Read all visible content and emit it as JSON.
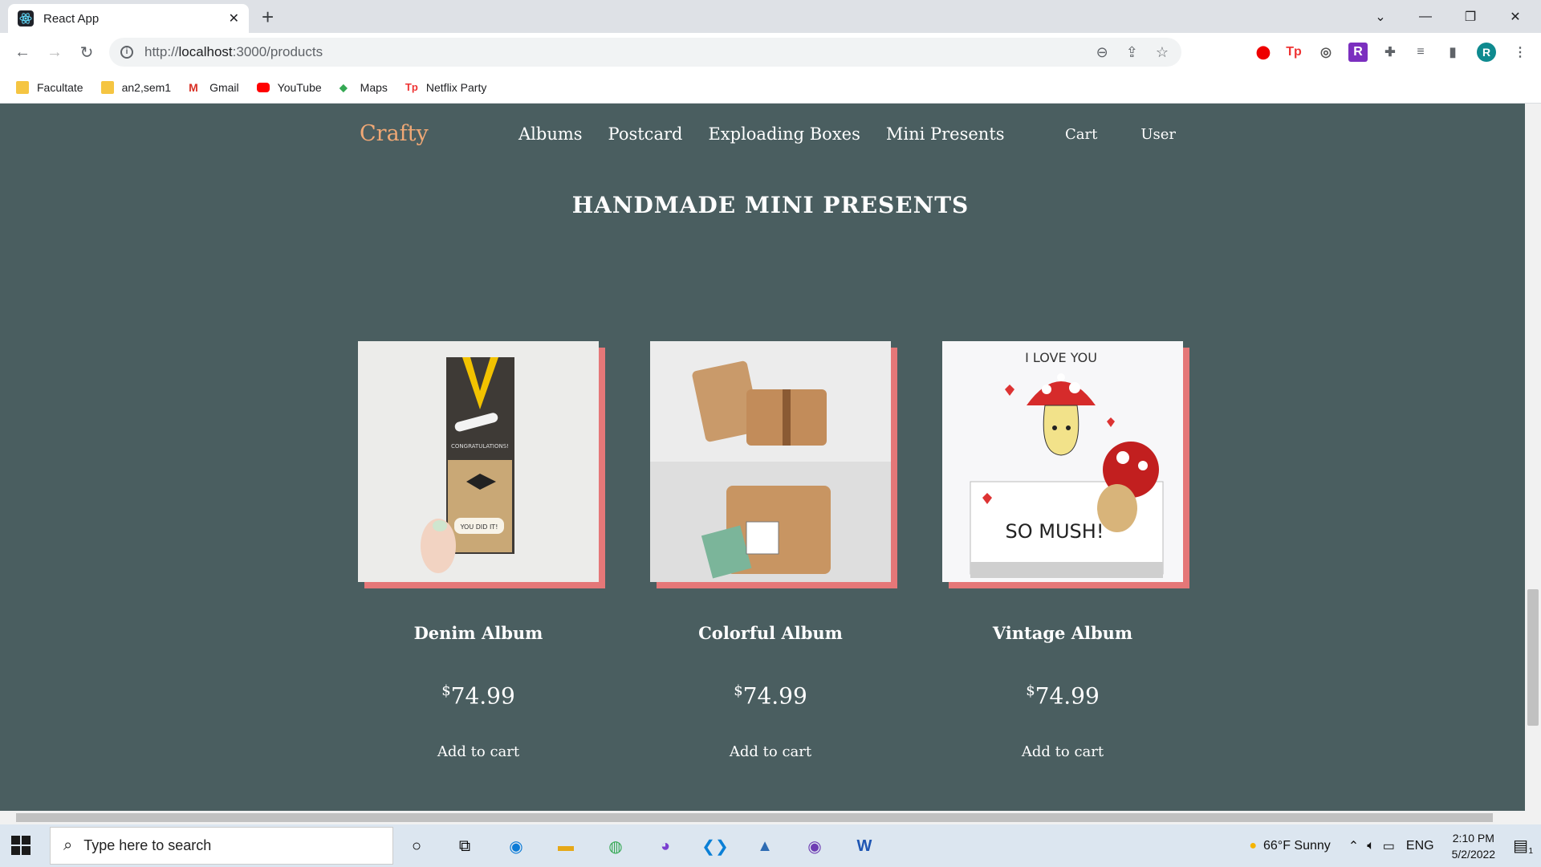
{
  "browser": {
    "tab_title": "React App",
    "url_prefix": "http://",
    "url_host": "localhost",
    "url_rest": ":3000/products",
    "profile_initial": "R",
    "bookmarks": [
      {
        "label": "Facultate",
        "icon": "folder-icon"
      },
      {
        "label": "an2,sem1",
        "icon": "folder-icon"
      },
      {
        "label": "Gmail",
        "icon": "gmail-icon"
      },
      {
        "label": "YouTube",
        "icon": "youtube-icon"
      },
      {
        "label": "Maps",
        "icon": "maps-icon"
      },
      {
        "label": "Netflix Party",
        "icon": "netflix-party-icon"
      }
    ]
  },
  "site": {
    "brand": "Crafty",
    "nav": [
      "Albums",
      "Postcard",
      "Exploading Boxes",
      "Mini Presents"
    ],
    "cart": "Cart",
    "user": "User",
    "heading": "HANDMADE MINI PRESENTS",
    "products": [
      {
        "title": "Denim Album",
        "currency": "$",
        "price": "74.99",
        "cta": "Add to cart"
      },
      {
        "title": "Colorful Album",
        "currency": "$",
        "price": "74.99",
        "cta": "Add to cart"
      },
      {
        "title": "Vintage Album",
        "currency": "$",
        "price": "74.99",
        "cta": "Add to cart"
      }
    ],
    "image_text": {
      "love": "I LOVE YOU",
      "mush": "SO MUSH!",
      "congrats": "CONGRATULATIONS!",
      "you_did_it": "YOU DID IT!"
    }
  },
  "taskbar": {
    "search_placeholder": "Type here to search",
    "weather": "66°F  Sunny",
    "lang": "ENG",
    "time": "2:10 PM",
    "date": "5/2/2022",
    "notif_count": "1"
  },
  "colors": {
    "page_bg": "#4a5e60",
    "brand": "#f0a875",
    "accent_shadow": "#e57778"
  }
}
